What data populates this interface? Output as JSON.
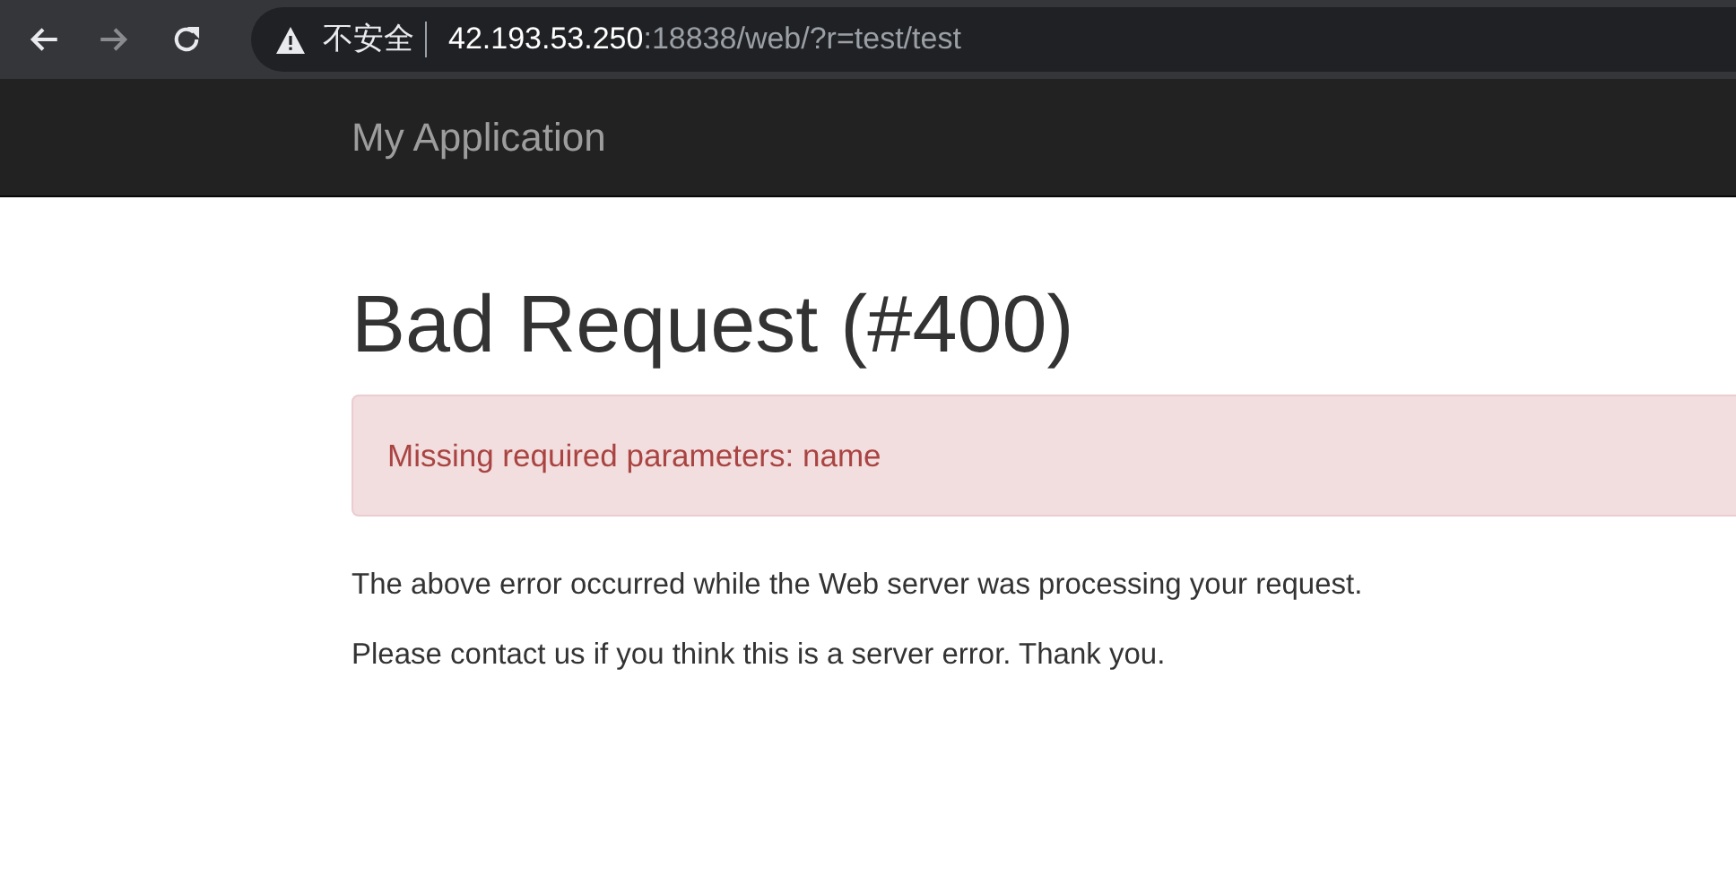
{
  "browser": {
    "nav_buttons": [
      {
        "kind": "back",
        "disabled": false
      },
      {
        "kind": "forward",
        "disabled": true
      },
      {
        "kind": "reload",
        "disabled": false
      }
    ],
    "security_label": "不安全",
    "url_host": "42.193.53.250",
    "url_rest": ":18838/web/?r=test/test"
  },
  "navbar": {
    "brand": "My Application"
  },
  "error": {
    "title": "Bad Request (#400)",
    "message": "Missing required parameters: name",
    "paragraphs": [
      "The above error occurred while the Web server was processing your request.",
      "Please contact us if you think this is a server error. Thank you."
    ]
  }
}
